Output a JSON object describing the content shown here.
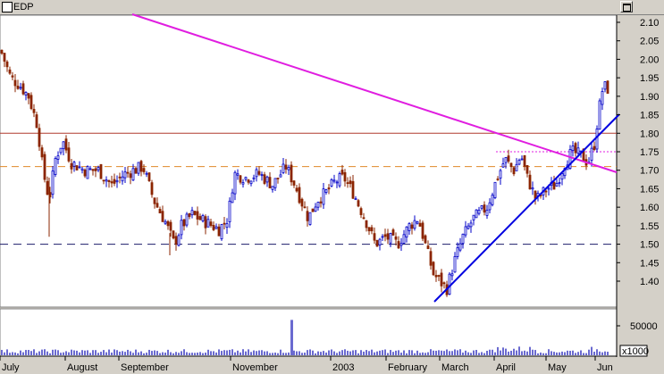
{
  "window": {
    "title": "EDP"
  },
  "colors": {
    "panel_bg": "#ffffff",
    "up_candle": "#0000c8",
    "down_candle": "#8b2500",
    "resistance": "#b03a2e",
    "dashed_orange": "#e08a2a",
    "dashed_navy": "#1c1c6b",
    "magenta": "#e01ee0",
    "uptrend": "#0000e0",
    "volume": "#6a6ad0"
  },
  "chart_data": [
    {
      "type": "candlestick",
      "series_name": "EDP",
      "y_axis_ticks": [
        "2.10",
        "2.05",
        "2.00",
        "1.95",
        "1.90",
        "1.85",
        "1.80",
        "1.75",
        "1.70",
        "1.65",
        "1.60",
        "1.55",
        "1.50",
        "1.45",
        "1.40"
      ],
      "ylim": [
        1.35,
        2.12
      ],
      "x_axis_labels": [
        "July",
        "August",
        "September",
        "November",
        "2003",
        "February",
        "March",
        "April",
        "May",
        "Jun"
      ],
      "price_path": [
        [
          0,
          2.03
        ],
        [
          12,
          1.95
        ],
        [
          22,
          1.93
        ],
        [
          32,
          1.9
        ],
        [
          42,
          1.82
        ],
        [
          48,
          1.7
        ],
        [
          55,
          1.62
        ],
        [
          62,
          1.73
        ],
        [
          70,
          1.78
        ],
        [
          80,
          1.72
        ],
        [
          95,
          1.7
        ],
        [
          110,
          1.7
        ],
        [
          125,
          1.66
        ],
        [
          140,
          1.69
        ],
        [
          160,
          1.71
        ],
        [
          172,
          1.62
        ],
        [
          185,
          1.56
        ],
        [
          195,
          1.5
        ],
        [
          203,
          1.55
        ],
        [
          215,
          1.58
        ],
        [
          230,
          1.56
        ],
        [
          245,
          1.54
        ],
        [
          255,
          1.57
        ],
        [
          262,
          1.69
        ],
        [
          275,
          1.68
        ],
        [
          290,
          1.69
        ],
        [
          305,
          1.66
        ],
        [
          320,
          1.71
        ],
        [
          330,
          1.66
        ],
        [
          345,
          1.57
        ],
        [
          355,
          1.62
        ],
        [
          365,
          1.64
        ],
        [
          375,
          1.67
        ],
        [
          385,
          1.68
        ],
        [
          395,
          1.64
        ],
        [
          410,
          1.56
        ],
        [
          420,
          1.5
        ],
        [
          432,
          1.52
        ],
        [
          445,
          1.5
        ],
        [
          458,
          1.55
        ],
        [
          468,
          1.57
        ],
        [
          478,
          1.48
        ],
        [
          485,
          1.42
        ],
        [
          492,
          1.4
        ],
        [
          500,
          1.38
        ],
        [
          508,
          1.45
        ],
        [
          518,
          1.52
        ],
        [
          530,
          1.57
        ],
        [
          545,
          1.6
        ],
        [
          555,
          1.67
        ],
        [
          565,
          1.73
        ],
        [
          575,
          1.7
        ],
        [
          583,
          1.74
        ],
        [
          590,
          1.68
        ],
        [
          600,
          1.62
        ],
        [
          612,
          1.65
        ],
        [
          622,
          1.66
        ],
        [
          632,
          1.72
        ],
        [
          640,
          1.75
        ],
        [
          650,
          1.74
        ],
        [
          658,
          1.72
        ],
        [
          665,
          1.77
        ],
        [
          670,
          1.86
        ],
        [
          675,
          1.93
        ],
        [
          679,
          1.92
        ]
      ],
      "lines": {
        "resistance_solid": 1.8,
        "resistance_dashed": 1.71,
        "support_dashed": 1.5,
        "short_dashed_level": 1.75
      }
    },
    {
      "type": "bar",
      "series_name": "Volume",
      "y_axis_ticks": [
        "50000"
      ],
      "y_axis_unit": "x1000",
      "spike_value": 60000,
      "baseline_value": 8000
    }
  ]
}
